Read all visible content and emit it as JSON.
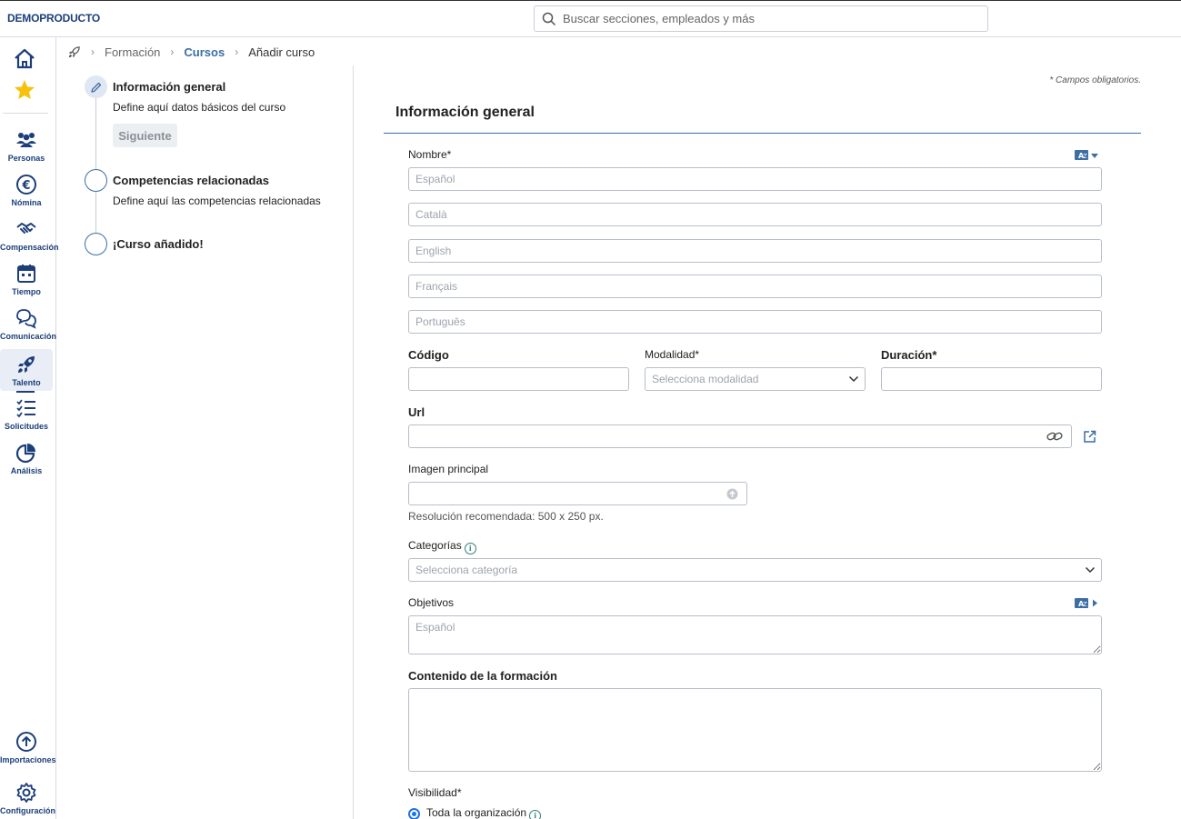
{
  "app": {
    "brand": "DEMOPRODUCTO"
  },
  "search": {
    "placeholder": "Buscar secciones, empleados y más"
  },
  "sidebar": {
    "items": [
      {
        "label": "Personas"
      },
      {
        "label": "Nómina"
      },
      {
        "label": "Compensación"
      },
      {
        "label": "Tiempo"
      },
      {
        "label": "Comunicación"
      },
      {
        "label": "Talento"
      },
      {
        "label": "Solicitudes"
      },
      {
        "label": "Análisis"
      },
      {
        "label": "Importaciones"
      },
      {
        "label": "Configuración"
      }
    ]
  },
  "breadcrumb": {
    "items": [
      "Formación",
      "Cursos",
      "Añadir curso"
    ]
  },
  "steps": {
    "items": [
      {
        "title": "Información general",
        "desc": "Define aquí datos básicos del curso"
      },
      {
        "title": "Competencias relacionadas",
        "desc": "Define aquí las competencias relacionadas"
      },
      {
        "title": "¡Curso añadido!",
        "desc": ""
      }
    ],
    "next_label": "Siguiente"
  },
  "form": {
    "required_note": "* Campos obligatorios.",
    "section_title": "Información general",
    "nombre": {
      "label": "Nombre*",
      "languages": [
        "Español",
        "Català",
        "English",
        "Français",
        "Português"
      ]
    },
    "codigo": {
      "label": "Código",
      "value": ""
    },
    "modalidad": {
      "label": "Modalidad*",
      "placeholder": "Selecciona modalidad"
    },
    "duracion": {
      "label": "Duración*",
      "value": ""
    },
    "url": {
      "label": "Url",
      "value": ""
    },
    "imagen": {
      "label": "Imagen principal",
      "helper": "Resolución recomendada: 500 x 250 px."
    },
    "categorias": {
      "label": "Categorías",
      "placeholder": "Selecciona categoría"
    },
    "objetivos": {
      "label": "Objetivos",
      "placeholder": "Español"
    },
    "contenido": {
      "label": "Contenido de la formación"
    },
    "visibilidad": {
      "label": "Visibilidad*",
      "option": "Toda la organización"
    }
  },
  "colors": {
    "brand": "#1c3f7a",
    "accent": "#3a6ea5",
    "radio": "#1a73e8"
  }
}
